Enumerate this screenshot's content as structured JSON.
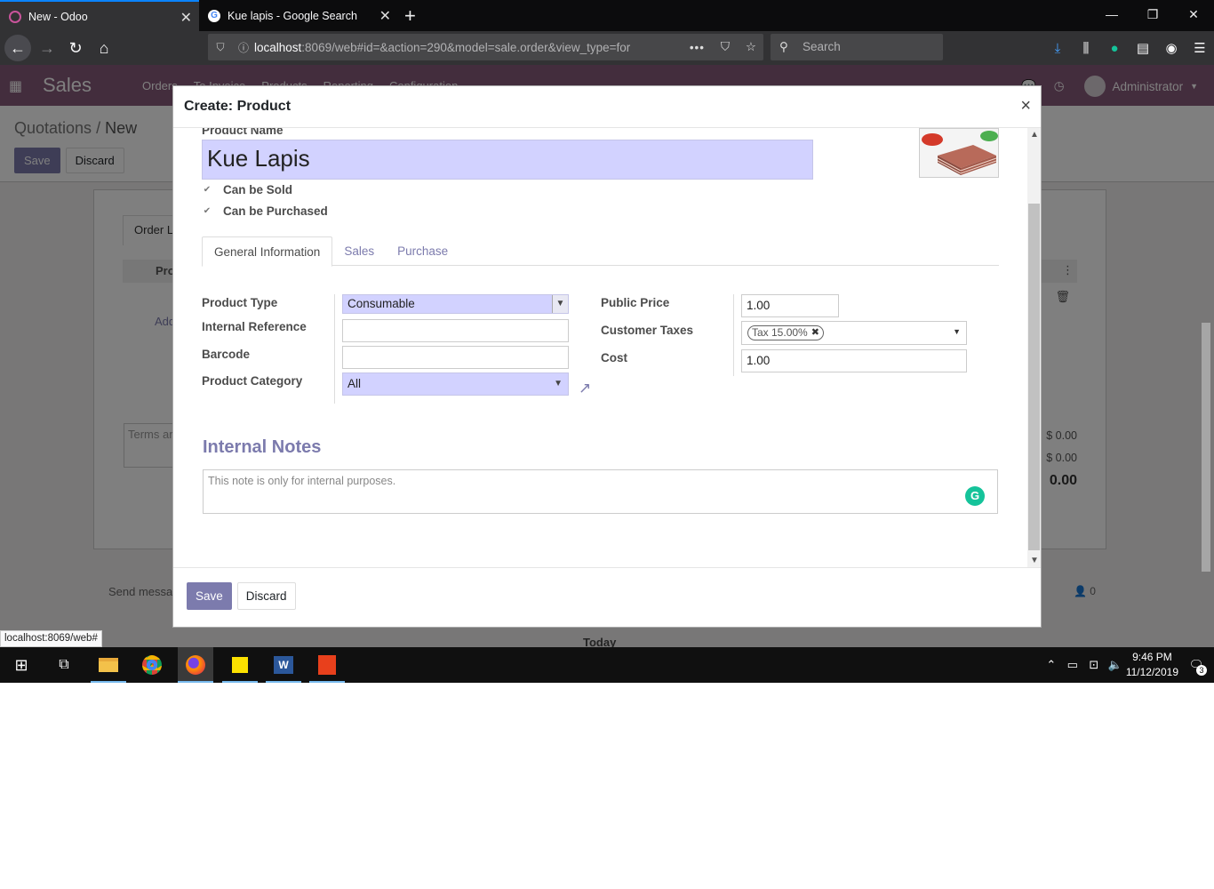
{
  "browser": {
    "tabs": [
      {
        "title": "New - Odoo",
        "active": true
      },
      {
        "title": "Kue lapis - Google Search",
        "active": false
      }
    ],
    "url_host": "localhost",
    "url_rest": ":8069/web#id=&action=290&model=sale.order&view_type=for",
    "search_placeholder": "Search",
    "status_url": "localhost:8069/web#"
  },
  "odoo": {
    "app_name": "Sales",
    "menu": [
      "Orders",
      "To Invoice",
      "Products",
      "Reporting",
      "Configuration"
    ],
    "user": "Administrator",
    "breadcrumb_parent": "Quotations",
    "breadcrumb_sep": " / ",
    "breadcrumb_current": "New",
    "save_label": "Save",
    "discard_label": "Discard",
    "order_tab": "Order L",
    "product_col": "Pro",
    "add_line": "Add",
    "terms": "Terms ar",
    "amount1": "$ 0.00",
    "amount2": "$ 0.00",
    "amount_total": "0.00",
    "send_message": "Send messa",
    "followers": "0",
    "today": "Today"
  },
  "modal": {
    "title": "Create: Product",
    "close_symbol": "×",
    "product_name_label": "Product Name",
    "product_name_value": "Kue Lapis",
    "can_be_sold": "Can be Sold",
    "can_be_purchased": "Can be Purchased",
    "tabs": [
      "General Information",
      "Sales",
      "Purchase"
    ],
    "fields": {
      "product_type_label": "Product Type",
      "product_type_value": "Consumable",
      "internal_reference_label": "Internal Reference",
      "internal_reference_value": "",
      "barcode_label": "Barcode",
      "barcode_value": "",
      "product_category_label": "Product Category",
      "product_category_value": "All",
      "public_price_label": "Public Price",
      "public_price_value": "1.00",
      "customer_taxes_label": "Customer Taxes",
      "customer_taxes_tag": "Tax 15.00%",
      "cost_label": "Cost",
      "cost_value": "1.00"
    },
    "internal_notes_title": "Internal Notes",
    "internal_notes_placeholder": "This note is only for internal purposes.",
    "save_label": "Save",
    "discard_label": "Discard"
  },
  "taskbar": {
    "time": "9:46 PM",
    "date": "11/12/2019",
    "notifications": "3"
  },
  "colors": {
    "odoo_primary": "#875a7b",
    "button_primary": "#7c7bad",
    "required_field": "#d2d2ff",
    "firefox_tab_accent": "#0a84ff"
  }
}
